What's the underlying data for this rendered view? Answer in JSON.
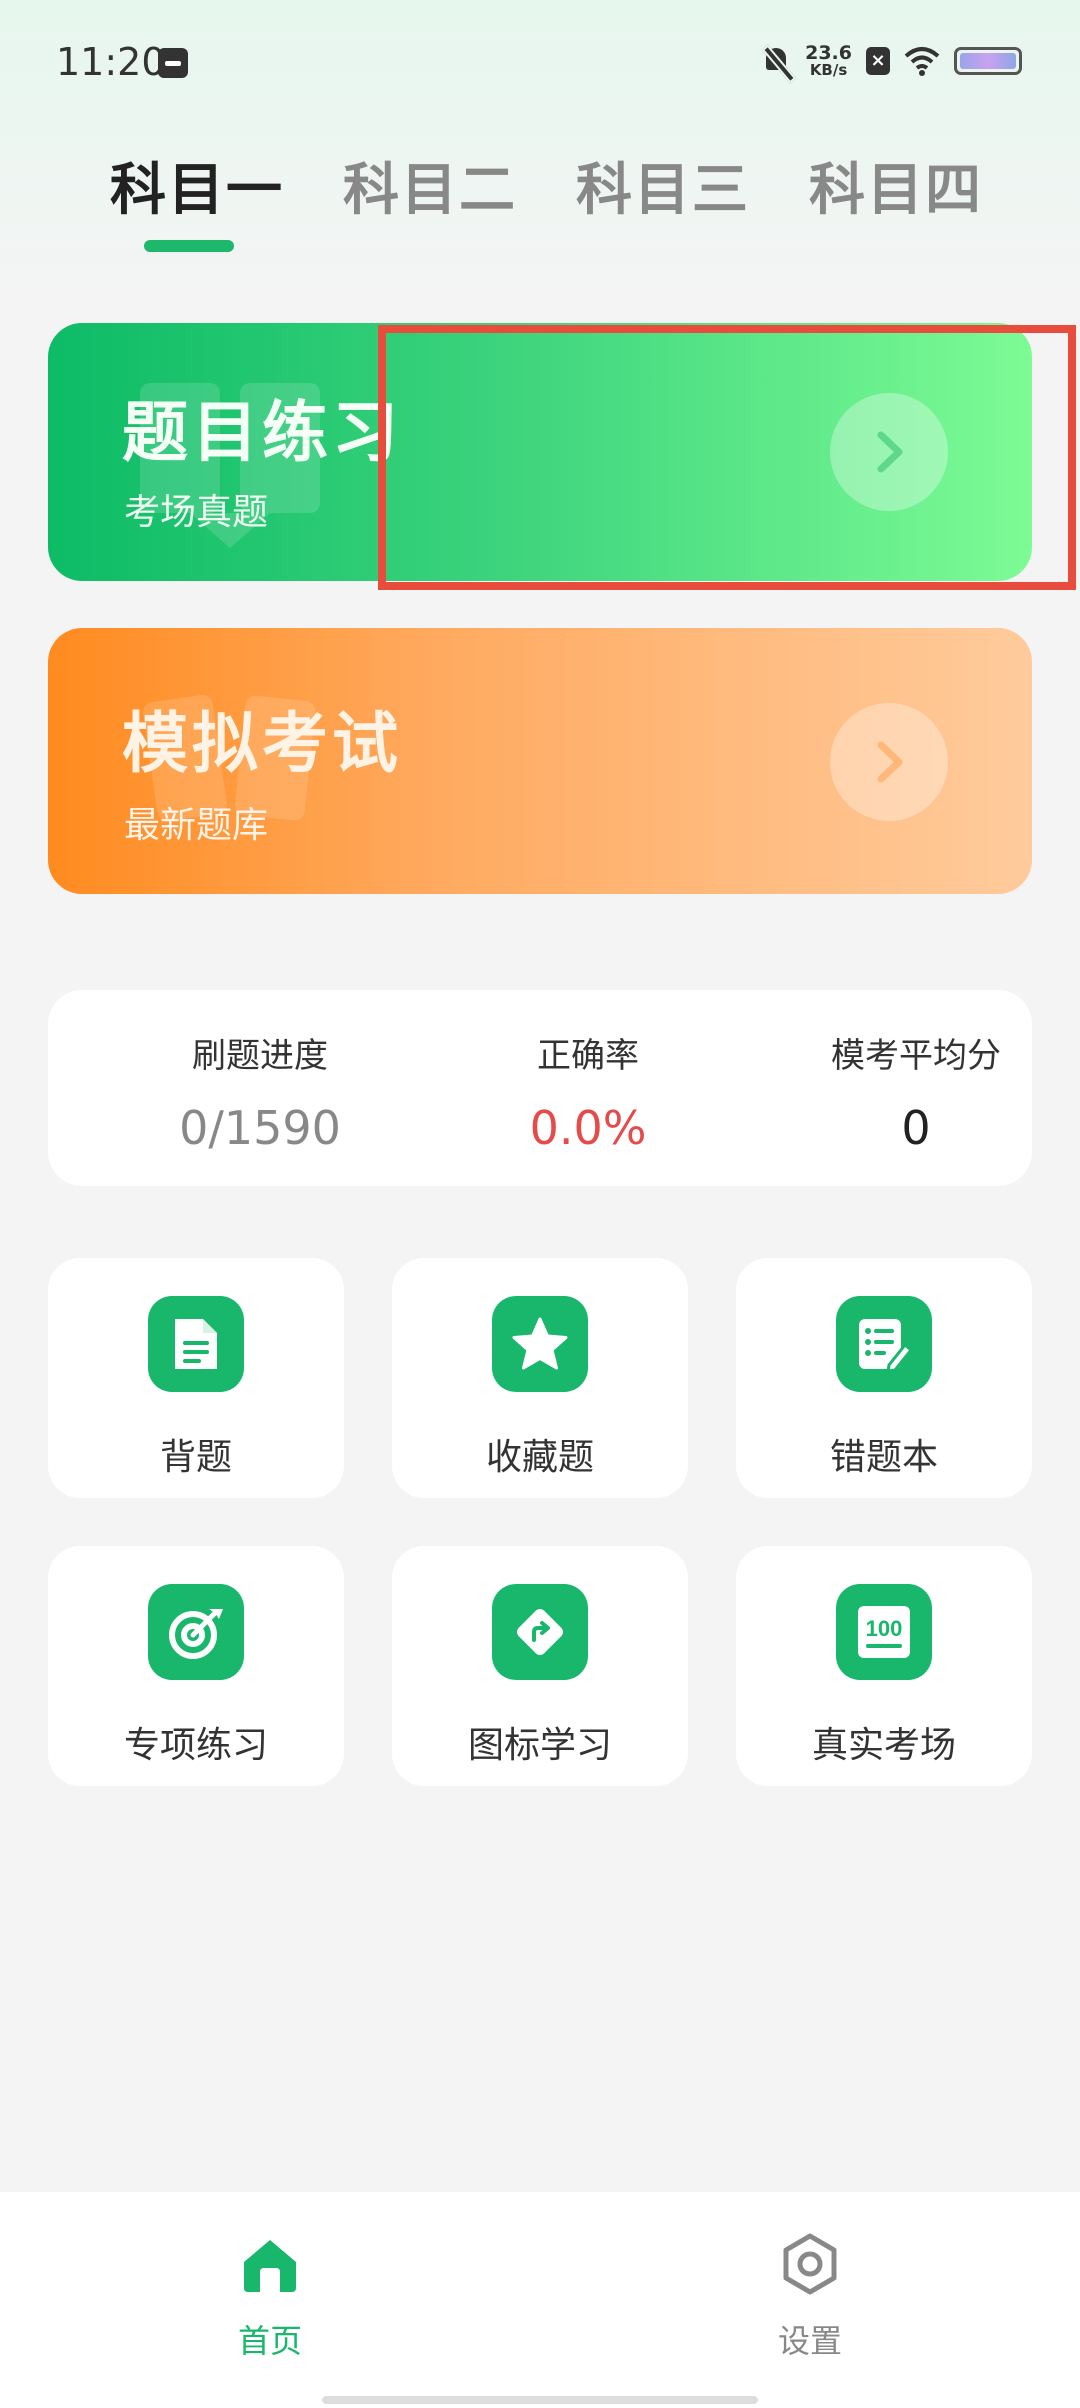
{
  "status_bar": {
    "time": "11:20",
    "net_speed_value": "23.6",
    "net_speed_unit": "KB/s",
    "icons": [
      "notification-app-icon",
      "mute-icon",
      "sim-off-icon",
      "wifi-icon",
      "battery-icon"
    ]
  },
  "tabs": [
    {
      "label": "科目一",
      "active": true
    },
    {
      "label": "科目二",
      "active": false
    },
    {
      "label": "科目三",
      "active": false
    },
    {
      "label": "科目四",
      "active": false
    }
  ],
  "banners": {
    "practice": {
      "title": "题目练习",
      "subtitle": "考场真题",
      "icon": "chevron-right-icon"
    },
    "exam": {
      "title": "模拟考试",
      "subtitle": "最新题库",
      "icon": "chevron-right-icon"
    }
  },
  "stats": [
    {
      "label": "刷题进度",
      "value": "0/1590"
    },
    {
      "label": "正确率",
      "value": "0.0%"
    },
    {
      "label": "模考平均分",
      "value": "0"
    }
  ],
  "grid": [
    {
      "label": "背题",
      "icon": "document-icon"
    },
    {
      "label": "收藏题",
      "icon": "star-icon"
    },
    {
      "label": "错题本",
      "icon": "notebook-edit-icon"
    },
    {
      "label": "专项练习",
      "icon": "target-icon"
    },
    {
      "label": "图标学习",
      "icon": "road-sign-icon"
    },
    {
      "label": "真实考场",
      "icon": "score-100-icon"
    }
  ],
  "grid_icon_text": {
    "score": "100"
  },
  "bottom_nav": [
    {
      "label": "首页",
      "icon": "home-icon",
      "active": true
    },
    {
      "label": "设置",
      "icon": "settings-hexagon-icon",
      "active": false
    }
  ],
  "colors": {
    "brand_green": "#18b76b",
    "practice_gradient": [
      "#0dbb66",
      "#7dfb95"
    ],
    "exam_gradient": [
      "#ff8b1f",
      "#ffcb9c"
    ],
    "accuracy_red": "#e64b4b",
    "highlight_red": "#e74c3c"
  }
}
